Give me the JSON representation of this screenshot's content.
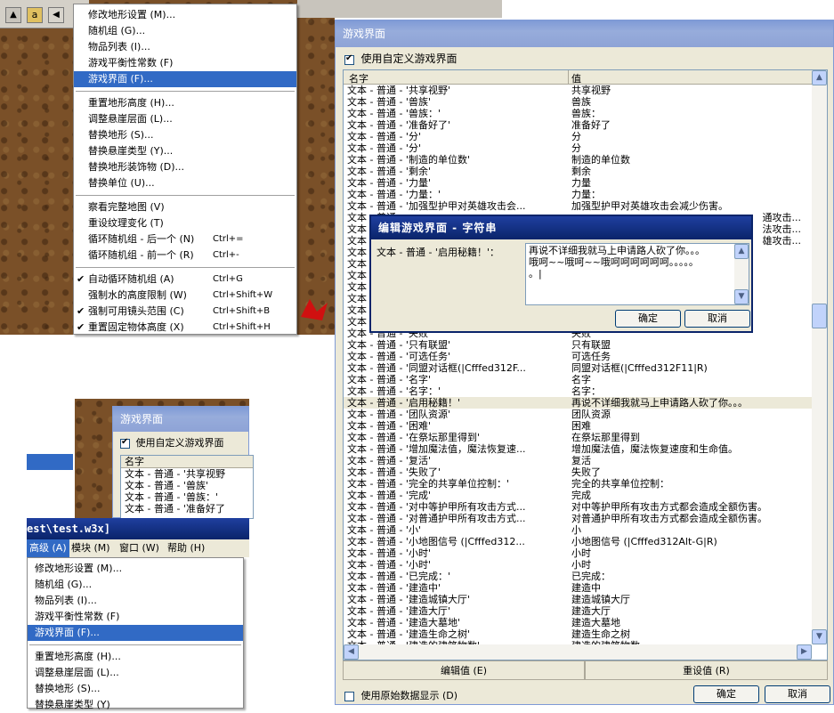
{
  "top_menu": {
    "items": [
      {
        "label": "修改地形设置 (M)...",
        "shortcut": "",
        "checked": false
      },
      {
        "label": "随机组 (G)...",
        "shortcut": "",
        "checked": false
      },
      {
        "label": "物品列表 (I)...",
        "shortcut": "",
        "checked": false
      },
      {
        "label": "游戏平衡性常数 (F)",
        "shortcut": "",
        "checked": false
      },
      {
        "label": "游戏界面 (F)...",
        "shortcut": "",
        "checked": false,
        "selected": true
      },
      {
        "separator": true
      },
      {
        "label": "重置地形高度 (H)...",
        "shortcut": "",
        "checked": false
      },
      {
        "label": "调整悬崖层面 (L)...",
        "shortcut": "",
        "checked": false
      },
      {
        "label": "替换地形 (S)...",
        "shortcut": "",
        "checked": false
      },
      {
        "label": "替换悬崖类型 (Y)...",
        "shortcut": "",
        "checked": false
      },
      {
        "label": "替换地形装饰物 (D)...",
        "shortcut": "",
        "checked": false
      },
      {
        "label": "替换单位 (U)...",
        "shortcut": "",
        "checked": false
      },
      {
        "separator": true
      },
      {
        "label": "察看完整地图 (V)",
        "shortcut": "",
        "checked": false
      },
      {
        "label": "重设纹理变化 (T)",
        "shortcut": "",
        "checked": false
      },
      {
        "label": "循环随机组 - 后一个 (N)",
        "shortcut": "Ctrl+=",
        "checked": false
      },
      {
        "label": "循环随机组 - 前一个 (R)",
        "shortcut": "Ctrl+-",
        "checked": false
      },
      {
        "separator": true
      },
      {
        "label": "自动循环随机组 (A)",
        "shortcut": "Ctrl+G",
        "checked": true
      },
      {
        "label": "强制水的高度限制 (W)",
        "shortcut": "Ctrl+Shift+W",
        "checked": false
      },
      {
        "label": "强制可用镜头范围 (C)",
        "shortcut": "Ctrl+Shift+B",
        "checked": true
      },
      {
        "label": "重置固定物体高度 (X)",
        "shortcut": "Ctrl+Shift+H",
        "checked": true
      }
    ]
  },
  "small_dialog": {
    "title": "游戏界面",
    "checkbox_label": "使用自定义游戏界面",
    "col_name": "名字",
    "rows": [
      "文本 - 普通 - '共享视野",
      "文本 - 普通 - '兽族'",
      "文本 - 普通 - '兽族：'",
      "文本 - 普通 - '准备好了"
    ]
  },
  "editor_bar": {
    "title": "est\\test.w3x]",
    "menus": [
      "高级 (A)",
      "模块 (M)",
      "窗口 (W)",
      "帮助 (H)"
    ]
  },
  "bottom_menu": {
    "items": [
      {
        "label": "修改地形设置 (M)..."
      },
      {
        "label": "随机组 (G)..."
      },
      {
        "label": "物品列表 (I)..."
      },
      {
        "label": "游戏平衡性常数 (F)"
      },
      {
        "label": "游戏界面 (F)...",
        "selected": true
      },
      {
        "separator": true
      },
      {
        "label": "重置地形高度 (H)..."
      },
      {
        "label": "调整悬崖层面 (L)..."
      },
      {
        "label": "替换地形 (S)..."
      },
      {
        "label": "替换悬崖类型 (Y)"
      }
    ]
  },
  "main_dialog": {
    "title": "游戏界面",
    "checkbox_label": "使用自定义游戏界面",
    "col_name": "名字",
    "col_value": "值",
    "rows_top": [
      [
        "文本 - 普通 - '共享视野'",
        "共享视野"
      ],
      [
        "文本 - 普通 - '兽族'",
        "兽族"
      ],
      [
        "文本 - 普通 - '兽族：'",
        "兽族："
      ],
      [
        "文本 - 普通 - '准备好了'",
        "准备好了"
      ],
      [
        "文本 - 普通 - '分'",
        "分"
      ],
      [
        "文本 - 普通 - '分'",
        "分"
      ],
      [
        "文本 - 普通 - '制造的单位数'",
        "制造的单位数"
      ],
      [
        "文本 - 普通 - '剩余'",
        "剩余"
      ],
      [
        "文本 - 普通 - '力量'",
        "力量"
      ],
      [
        "文本 - 普通 - '力量：'",
        "力量："
      ],
      [
        "文本 - 普通 - '加强型护甲对英雄攻击会...",
        "加强型护甲对英雄攻击会减少伤害。"
      ]
    ],
    "rows_hidden_right": [
      "通攻击...",
      "法攻击...",
      "雄攻击..."
    ],
    "rows_mid_stub": [
      "文本 - 普通 -",
      "文本 - 普通 -",
      "文本 - 普通 -",
      "文本 - 普通 -",
      "文本 - 普通 -",
      "文本 - 普通 -",
      "文本 - 普通 -",
      "文本 - 普通 -",
      "文本 - 普通 -",
      "文本 - 普通 -"
    ],
    "row_partial": [
      "文本 - 普通 - '失败'",
      "失败"
    ],
    "rows_bottom": [
      [
        "文本 - 普通 - '只有联盟'",
        "只有联盟"
      ],
      [
        "文本 - 普通 - '可选任务'",
        "可选任务"
      ],
      [
        "文本 - 普通 - '同盟对话框(|Cfffed312F...",
        "同盟对话框(|Cfffed312F11|R)"
      ],
      [
        "文本 - 普通 - '名字'",
        "名字"
      ],
      [
        "文本 - 普通 - '名字：'",
        "名字："
      ],
      [
        "文本 - 普通 - '启用秘籍！'",
        "再说不详细我就马上申请路人砍了你。。。"
      ],
      [
        "文本 - 普通 - '团队资源'",
        "团队资源"
      ],
      [
        "文本 - 普通 - '困难'",
        "困难"
      ],
      [
        "文本 - 普通 - '在祭坛那里得到'",
        "在祭坛那里得到"
      ],
      [
        "文本 - 普通 - '增加魔法值，魔法恢复速...",
        "增加魔法值，魔法恢复速度和生命值。"
      ],
      [
        "文本 - 普通 - '复活'",
        "复活"
      ],
      [
        "文本 - 普通 - '失败了'",
        "失败了"
      ],
      [
        "文本 - 普通 - '完全的共享单位控制：'",
        "完全的共享单位控制："
      ],
      [
        "文本 - 普通 - '完成'",
        "完成"
      ],
      [
        "文本 - 普通 - '对中等护甲所有攻击方式...",
        "对中等护甲所有攻击方式都会造成全额伤害。"
      ],
      [
        "文本 - 普通 - '对普通护甲所有攻击方式...",
        "对普通护甲所有攻击方式都会造成全额伤害。"
      ],
      [
        "文本 - 普通 - '小'",
        "小"
      ],
      [
        "文本 - 普通 - '小地图信号 (|Cfffed312...",
        "小地图信号 (|Cfffed312Alt-G|R)"
      ],
      [
        "文本 - 普通 - '小时'",
        "小时"
      ],
      [
        "文本 - 普通 - '小时'",
        "小时"
      ],
      [
        "文本 - 普通 - '已完成：'",
        "已完成："
      ],
      [
        "文本 - 普通 - '建造中'",
        "建造中"
      ],
      [
        "文本 - 普通 - '建造城镇大厅'",
        "建造城镇大厅"
      ],
      [
        "文本 - 普通 - '建造大厅'",
        "建造大厅"
      ],
      [
        "文本 - 普通 - '建造大墓地'",
        "建造大墓地"
      ],
      [
        "文本 - 普通 - '建造生命之树'",
        "建造生命之树"
      ],
      [
        "文本 - 普通 - '建造的建筑物数'",
        "建造的建筑物数"
      ]
    ],
    "highlight_index": 5,
    "edit_value_button": "编辑值 (E)",
    "reset_value_button": "重设值 (R)",
    "raw_data_checkbox": "使用原始数据显示 (D)",
    "ok_button": "确定",
    "cancel_button": "取消"
  },
  "string_dialog": {
    "title": "编辑游戏界面 - 字符串",
    "field_label": "文本 - 普通 - '启用秘籍！'：",
    "text_lines": [
      "再说不详细我就马上申请路人砍了你。。。",
      "哦呵~~哦呵~~哦呵呵呵呵呵呵。。。。。",
      "。|"
    ],
    "ok_button": "确定",
    "cancel_button": "取消"
  },
  "colors": {
    "selection": "#316ac5",
    "title_blue": "#0a246a",
    "dialog_bg": "#ece9d8"
  }
}
